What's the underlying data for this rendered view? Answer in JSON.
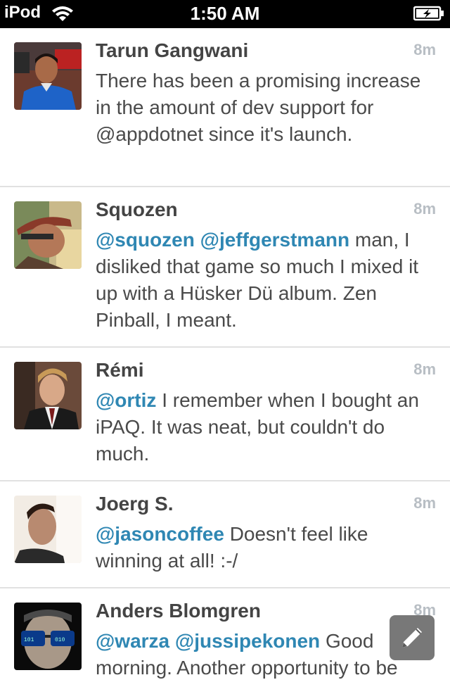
{
  "status_bar": {
    "carrier": "iPod",
    "time": "1:50 AM",
    "wifi_icon": "wifi-icon",
    "battery_icon": "battery-charging-icon"
  },
  "colors": {
    "mention": "#2f87b3",
    "name": "#444444",
    "body": "#4a4a4a",
    "time": "#b8bec4",
    "divider": "#e1e1e1"
  },
  "tweets": [
    {
      "name": "Tarun Gangwani",
      "time": "8m",
      "mentions": [],
      "text": "There has been a promising increase in the amount of dev support for @appdotnet since it's launch."
    },
    {
      "name": "Squozen",
      "time": "8m",
      "mentions": [
        "@squozen",
        "@jeffgerstmann"
      ],
      "text": "man, I disliked that game so much I mixed it up with a Hüsker Dü album. Zen Pinball, I meant."
    },
    {
      "name": "Rémi",
      "time": "8m",
      "mentions": [
        "@ortiz"
      ],
      "text": "I remember when I bought an iPAQ. It was neat, but couldn't do much."
    },
    {
      "name": "Joerg S.",
      "time": "8m",
      "mentions": [
        "@jasoncoffee"
      ],
      "text": "Doesn't feel like winning at all! :-/"
    },
    {
      "name": "Anders Blomgren",
      "time": "8m",
      "mentions": [
        "@warza",
        "@jussipekonen"
      ],
      "text": "Good morning. Another opportunity to be"
    }
  ],
  "compose": {
    "icon": "pencil-icon"
  }
}
